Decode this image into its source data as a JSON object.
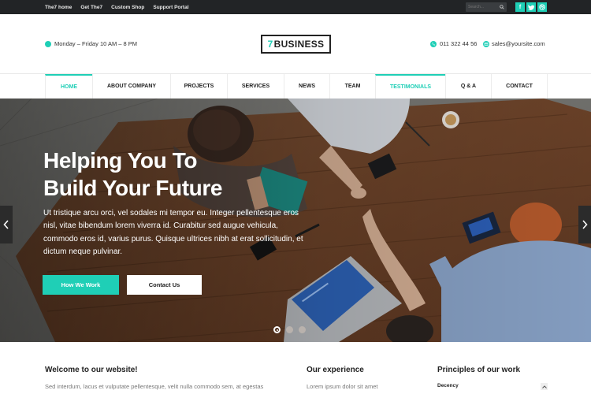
{
  "topbar": {
    "links": [
      "The7 home",
      "Get The7",
      "Custom Shop",
      "Support Portal"
    ],
    "search_placeholder": "Search...",
    "social": [
      "facebook-icon",
      "twitter-icon",
      "dribbble-icon"
    ]
  },
  "header": {
    "hours": "Monday – Friday 10 AM – 8 PM",
    "logo_number": "7",
    "logo_text": "BUSINESS",
    "phone": "011 322 44 56",
    "email": "sales@yoursite.com"
  },
  "nav": {
    "items": [
      {
        "label": "HOME",
        "active": true
      },
      {
        "label": "ABOUT COMPANY",
        "active": false
      },
      {
        "label": "PROJECTS",
        "active": false
      },
      {
        "label": "SERVICES",
        "active": false
      },
      {
        "label": "NEWS",
        "active": false
      },
      {
        "label": "TEAM",
        "active": false
      },
      {
        "label": "TESTIMONIALS",
        "active": true
      },
      {
        "label": "Q & A",
        "active": false
      },
      {
        "label": "CONTACT",
        "active": false
      }
    ]
  },
  "hero": {
    "title_line1": "Helping You To",
    "title_line2": "Build Your Future",
    "text": "Ut tristique arcu orci, vel sodales mi tempor eu. Integer pellentesque eros nisl, vitae bibendum lorem viverra id. Curabitur sed augue vehicula, commodo eros id, varius purus. Quisque ultrices nibh at erat sollicitudin, et dictum neque pulvinar.",
    "primary_button": "How We Work",
    "secondary_button": "Contact Us",
    "slides_total": 3,
    "slide_active": 1
  },
  "sections": {
    "welcome_title": "Welcome to our website!",
    "welcome_text": "Sed interdum, lacus et vulputate pellentesque, velit nulla commodo sem, at egestas",
    "experience_title": "Our experience",
    "experience_text": "Lorem ipsum dolor sit amet",
    "principles_title": "Principles of our work",
    "principles_first_item": "Decency"
  },
  "colors": {
    "accent": "#1fcfb6",
    "topbar": "#222426",
    "text_dark": "#222222"
  }
}
